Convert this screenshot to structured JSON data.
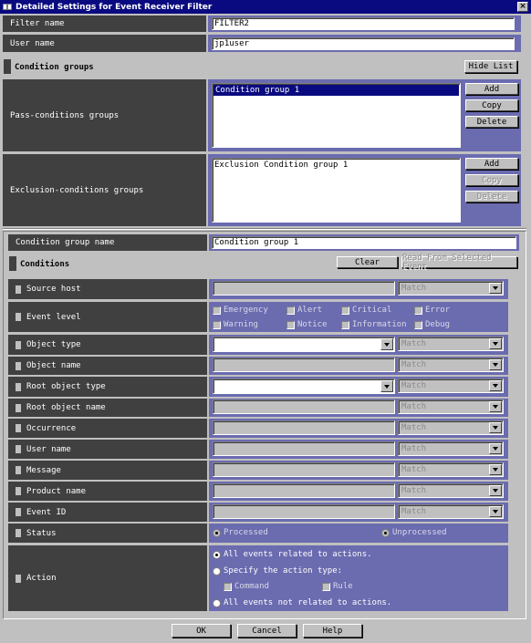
{
  "window": {
    "title": "Detailed Settings for Event Receiver Filter",
    "close": "×"
  },
  "filter_name": {
    "label": "Filter name",
    "value": "FILTER2"
  },
  "user_name": {
    "label": "User name",
    "value": "jp1user"
  },
  "condition_groups": {
    "label": "Condition groups",
    "hide_list": "Hide List"
  },
  "pass_groups": {
    "label": "Pass-conditions groups",
    "items": [
      "Condition group 1"
    ],
    "add": "Add",
    "copy": "Copy",
    "delete": "Delete"
  },
  "exclusion_groups": {
    "label": "Exclusion-conditions groups",
    "items": [
      "Exclusion Condition group 1"
    ],
    "add": "Add",
    "copy": "Copy",
    "delete": "Delete"
  },
  "group_name": {
    "label": "Condition group name",
    "value": "Condition group 1"
  },
  "conditions": {
    "label": "Conditions",
    "clear": "Clear",
    "read": "Read From Selected Event"
  },
  "match_placeholder": "Match",
  "rows": {
    "source_host": "Source host",
    "event_level": "Event level",
    "object_type": "Object type",
    "object_name": "Object name",
    "root_object_type": "Root object type",
    "root_object_name": "Root object name",
    "occurrence": "Occurrence",
    "user_name": "User name",
    "message": "Message",
    "product_name": "Product name",
    "event_id": "Event ID",
    "status": "Status",
    "action": "Action"
  },
  "event_levels": [
    "Emergency",
    "Alert",
    "Critical",
    "Error",
    "Warning",
    "Notice",
    "Information",
    "Debug"
  ],
  "status_options": [
    "Processed",
    "Unprocessed"
  ],
  "action_options": {
    "all_related": "All events related to actions.",
    "specify": "Specify the action type:",
    "command": "Command",
    "rule": "Rule",
    "not_related": "All events not related to actions."
  },
  "footer": {
    "ok": "OK",
    "cancel": "Cancel",
    "help": "Help"
  }
}
